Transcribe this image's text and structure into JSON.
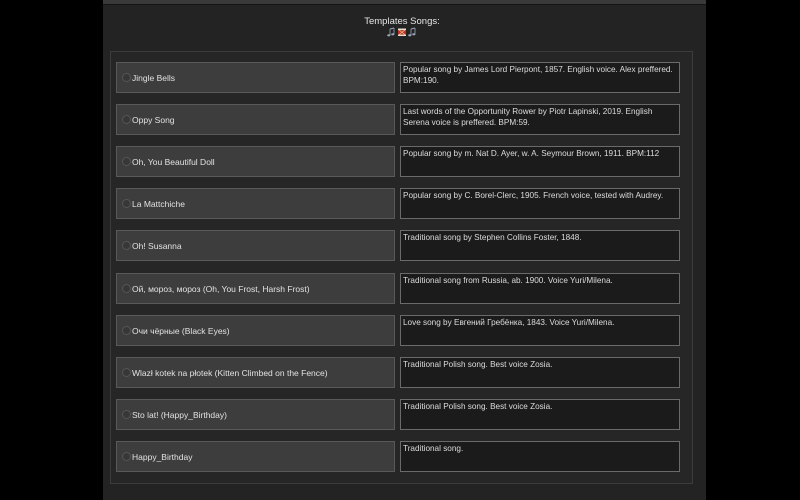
{
  "header": {
    "title": "Templates Songs:",
    "icon": "music-notes-drum-icon"
  },
  "songs": [
    {
      "label": "Jingle Bells",
      "description": "Popular song by James Lord Pierpont, 1857. English voice. Alex preffered. BPM:190."
    },
    {
      "label": "Oppy Song",
      "description": "Last words of the Opportunity Rower by Piotr Lapinski, 2019.  English Serena voice is preffered. BPM:59."
    },
    {
      "label": "Oh, You Beautiful Doll",
      "description": "Popular song by m. Nat D. Ayer, w. A. Seymour Brown, 1911. BPM:112"
    },
    {
      "label": "La Mattchiche",
      "description": "Popular song by C. Borel-Clerc, 1905. French voice, tested with Audrey."
    },
    {
      "label": "Oh! Susanna",
      "description": "Traditional song by Stephen Collins Foster, 1848."
    },
    {
      "label": "Ой, мороз, мороз (Oh, You Frost, Harsh Frost)",
      "description": "Traditional song from Russia, ab. 1900. Voice Yuri/Milena."
    },
    {
      "label": "Очи чёрные (Black Eyes)",
      "description": "Love song by Евгений Гребёнка, 1843. Voice Yuri/Milena."
    },
    {
      "label": "Wlazł kotek na płotek (Kitten Climbed on the Fence)",
      "description": "Traditional Polish song. Best voice Zosia."
    },
    {
      "label": "Sto lat! (Happy_Birthday)",
      "description": "Traditional Polish song. Best voice Zosia."
    },
    {
      "label": "Happy_Birthday",
      "description": "Traditional song."
    }
  ]
}
